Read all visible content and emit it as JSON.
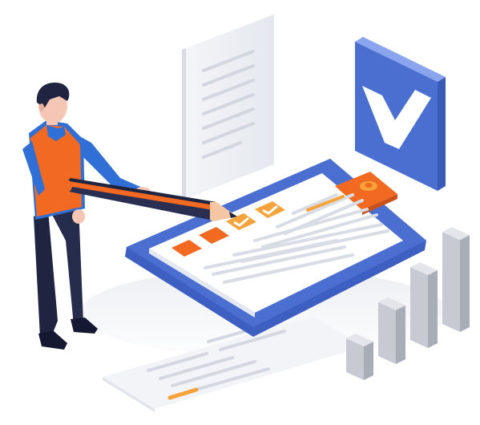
{
  "illustration": {
    "subject": "person-marking-checklist",
    "icons": [
      "checkmark-icon",
      "clipboard-icon",
      "pencil-icon",
      "document-icon",
      "bar-chart-icon"
    ],
    "checklist": {
      "checked_items": 2,
      "unchecked_items": 2
    },
    "bar_chart": {
      "bar_levels": [
        0.3,
        0.48,
        0.65,
        0.82
      ]
    },
    "colors": {
      "accent_orange": "#F26A21",
      "accent_orange_light": "#F7A33B",
      "brand_blue": "#4A6FD1",
      "brand_blue_light": "#6F8FE6",
      "pale_blue": "#E7EDFB",
      "navy": "#1F2440",
      "skin": "#F5C6B4",
      "hair": "#1F2440",
      "gray_line": "#D5D9E2",
      "bar_gray": "#CCCFD6"
    }
  }
}
